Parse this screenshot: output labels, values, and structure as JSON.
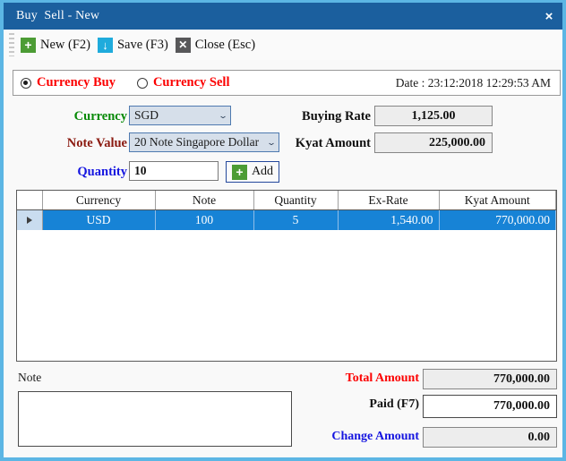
{
  "window": {
    "title": "Buy  Sell - New",
    "close_icon": "×"
  },
  "toolbar": {
    "new": {
      "label": "New (F2)",
      "icon": "+"
    },
    "save": {
      "label": "Save (F3)",
      "icon": "↓"
    },
    "close": {
      "label": "Close (Esc)",
      "icon": "✕"
    }
  },
  "mode": {
    "buy_label": "Currency Buy",
    "sell_label": "Currency Sell",
    "selected": "buy",
    "date_text": "Date : 23:12:2018 12:29:53 AM"
  },
  "form": {
    "currency_label": "Currency",
    "currency_value": "SGD",
    "note_value_label": "Note Value",
    "note_value_value": "20 Note Singapore Dollar",
    "quantity_label": "Quantity",
    "quantity_value": "10",
    "add_label": "Add",
    "add_icon": "+",
    "buying_rate_label": "Buying Rate",
    "buying_rate_value": "1,125.00",
    "kyat_amount_label": "Kyat Amount",
    "kyat_amount_value": "225,000.00",
    "dropdown_arrow": "⌄"
  },
  "grid": {
    "columns": [
      "Currency",
      "Note",
      "Quantity",
      "Ex-Rate",
      "Kyat Amount"
    ],
    "rows": [
      {
        "currency": "USD",
        "note": "100",
        "quantity": "5",
        "ex_rate": "1,540.00",
        "kyat_amount": "770,000.00",
        "selected": true
      }
    ]
  },
  "footer": {
    "note_label": "Note",
    "note_value": "",
    "total_amount_label": "Total Amount",
    "total_amount_value": "770,000.00",
    "paid_label": "Paid (F7)",
    "paid_value": "770,000.00",
    "change_amount_label": "Change Amount",
    "change_amount_value": "0.00"
  },
  "colors": {
    "titlebar": "#1b5f9e",
    "window_border": "#5cb6e4",
    "accent_red": "#fc0000",
    "accent_green": "#088a08",
    "accent_blue": "#1515e0",
    "accent_maroon": "#8b1a10",
    "grid_selection": "#1783d6"
  }
}
